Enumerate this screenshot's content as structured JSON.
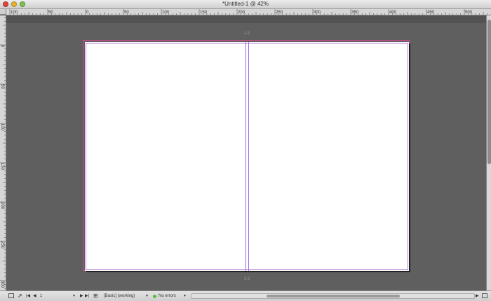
{
  "window": {
    "title": "*Untitled-1 @ 42%"
  },
  "rulers": {
    "horizontal_labels": [
      "100",
      "50",
      "0",
      "50",
      "100",
      "150",
      "200",
      "250",
      "300",
      "350",
      "400",
      "450",
      "500"
    ],
    "vertical_labels": [
      "0",
      "50",
      "100",
      "150",
      "200",
      "250",
      "300"
    ],
    "unit": "mm"
  },
  "document": {
    "spine_marker_top": "1-2",
    "spine_marker_bottom": "1-2"
  },
  "status": {
    "page_number": "1",
    "workspace": "[Basic] (working)",
    "preflight": "No errors"
  },
  "colors": {
    "bleed": "#d04a8a",
    "margin": "#b27ad8",
    "spine_guide": "#9966ee",
    "preflight_ok": "#4fbf3a"
  }
}
